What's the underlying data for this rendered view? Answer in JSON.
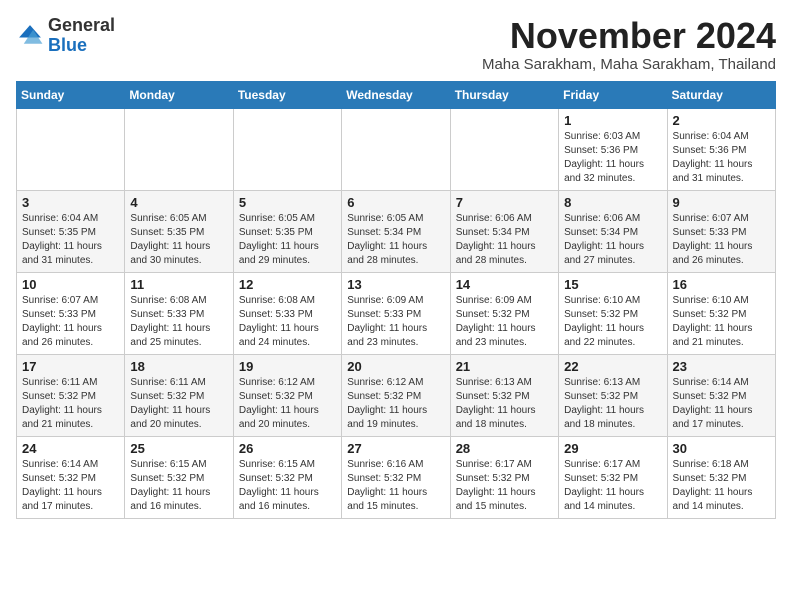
{
  "header": {
    "logo_line1": "General",
    "logo_line2": "Blue",
    "month_title": "November 2024",
    "subtitle": "Maha Sarakham, Maha Sarakham, Thailand"
  },
  "days_of_week": [
    "Sunday",
    "Monday",
    "Tuesday",
    "Wednesday",
    "Thursday",
    "Friday",
    "Saturday"
  ],
  "weeks": [
    [
      {
        "day": "",
        "info": ""
      },
      {
        "day": "",
        "info": ""
      },
      {
        "day": "",
        "info": ""
      },
      {
        "day": "",
        "info": ""
      },
      {
        "day": "",
        "info": ""
      },
      {
        "day": "1",
        "info": "Sunrise: 6:03 AM\nSunset: 5:36 PM\nDaylight: 11 hours and 32 minutes."
      },
      {
        "day": "2",
        "info": "Sunrise: 6:04 AM\nSunset: 5:36 PM\nDaylight: 11 hours and 31 minutes."
      }
    ],
    [
      {
        "day": "3",
        "info": "Sunrise: 6:04 AM\nSunset: 5:35 PM\nDaylight: 11 hours and 31 minutes."
      },
      {
        "day": "4",
        "info": "Sunrise: 6:05 AM\nSunset: 5:35 PM\nDaylight: 11 hours and 30 minutes."
      },
      {
        "day": "5",
        "info": "Sunrise: 6:05 AM\nSunset: 5:35 PM\nDaylight: 11 hours and 29 minutes."
      },
      {
        "day": "6",
        "info": "Sunrise: 6:05 AM\nSunset: 5:34 PM\nDaylight: 11 hours and 28 minutes."
      },
      {
        "day": "7",
        "info": "Sunrise: 6:06 AM\nSunset: 5:34 PM\nDaylight: 11 hours and 28 minutes."
      },
      {
        "day": "8",
        "info": "Sunrise: 6:06 AM\nSunset: 5:34 PM\nDaylight: 11 hours and 27 minutes."
      },
      {
        "day": "9",
        "info": "Sunrise: 6:07 AM\nSunset: 5:33 PM\nDaylight: 11 hours and 26 minutes."
      }
    ],
    [
      {
        "day": "10",
        "info": "Sunrise: 6:07 AM\nSunset: 5:33 PM\nDaylight: 11 hours and 26 minutes."
      },
      {
        "day": "11",
        "info": "Sunrise: 6:08 AM\nSunset: 5:33 PM\nDaylight: 11 hours and 25 minutes."
      },
      {
        "day": "12",
        "info": "Sunrise: 6:08 AM\nSunset: 5:33 PM\nDaylight: 11 hours and 24 minutes."
      },
      {
        "day": "13",
        "info": "Sunrise: 6:09 AM\nSunset: 5:33 PM\nDaylight: 11 hours and 23 minutes."
      },
      {
        "day": "14",
        "info": "Sunrise: 6:09 AM\nSunset: 5:32 PM\nDaylight: 11 hours and 23 minutes."
      },
      {
        "day": "15",
        "info": "Sunrise: 6:10 AM\nSunset: 5:32 PM\nDaylight: 11 hours and 22 minutes."
      },
      {
        "day": "16",
        "info": "Sunrise: 6:10 AM\nSunset: 5:32 PM\nDaylight: 11 hours and 21 minutes."
      }
    ],
    [
      {
        "day": "17",
        "info": "Sunrise: 6:11 AM\nSunset: 5:32 PM\nDaylight: 11 hours and 21 minutes."
      },
      {
        "day": "18",
        "info": "Sunrise: 6:11 AM\nSunset: 5:32 PM\nDaylight: 11 hours and 20 minutes."
      },
      {
        "day": "19",
        "info": "Sunrise: 6:12 AM\nSunset: 5:32 PM\nDaylight: 11 hours and 20 minutes."
      },
      {
        "day": "20",
        "info": "Sunrise: 6:12 AM\nSunset: 5:32 PM\nDaylight: 11 hours and 19 minutes."
      },
      {
        "day": "21",
        "info": "Sunrise: 6:13 AM\nSunset: 5:32 PM\nDaylight: 11 hours and 18 minutes."
      },
      {
        "day": "22",
        "info": "Sunrise: 6:13 AM\nSunset: 5:32 PM\nDaylight: 11 hours and 18 minutes."
      },
      {
        "day": "23",
        "info": "Sunrise: 6:14 AM\nSunset: 5:32 PM\nDaylight: 11 hours and 17 minutes."
      }
    ],
    [
      {
        "day": "24",
        "info": "Sunrise: 6:14 AM\nSunset: 5:32 PM\nDaylight: 11 hours and 17 minutes."
      },
      {
        "day": "25",
        "info": "Sunrise: 6:15 AM\nSunset: 5:32 PM\nDaylight: 11 hours and 16 minutes."
      },
      {
        "day": "26",
        "info": "Sunrise: 6:15 AM\nSunset: 5:32 PM\nDaylight: 11 hours and 16 minutes."
      },
      {
        "day": "27",
        "info": "Sunrise: 6:16 AM\nSunset: 5:32 PM\nDaylight: 11 hours and 15 minutes."
      },
      {
        "day": "28",
        "info": "Sunrise: 6:17 AM\nSunset: 5:32 PM\nDaylight: 11 hours and 15 minutes."
      },
      {
        "day": "29",
        "info": "Sunrise: 6:17 AM\nSunset: 5:32 PM\nDaylight: 11 hours and 14 minutes."
      },
      {
        "day": "30",
        "info": "Sunrise: 6:18 AM\nSunset: 5:32 PM\nDaylight: 11 hours and 14 minutes."
      }
    ]
  ]
}
